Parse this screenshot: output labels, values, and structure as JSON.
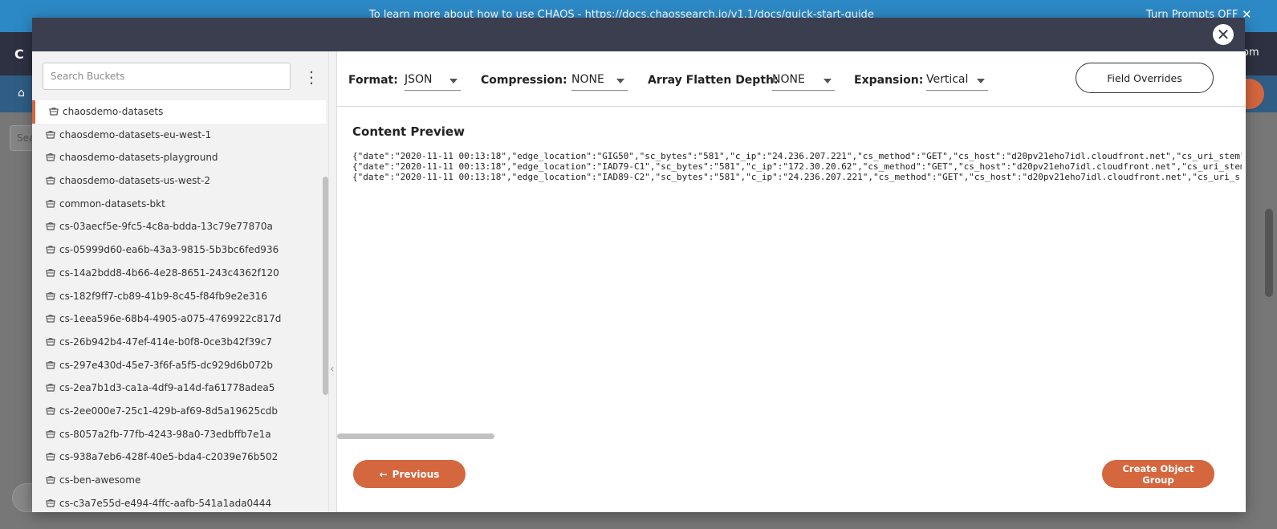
{
  "background": {
    "banner_text": "To learn more about how to use CHAOS - https://docs.chaossearch.io/v1.1/docs/quick-start-guide",
    "turn_prompts_label": "Turn Prompts OFF",
    "logo_partial": "C H",
    "user_partial": "om",
    "search_partial": "Sea"
  },
  "modal": {
    "close_icon": "close-icon"
  },
  "sidebar": {
    "search_placeholder": "Search Buckets",
    "menu_icon": "kebab-menu-icon",
    "collapse_icon": "chevron-left-icon",
    "buckets": [
      {
        "label": "chaosdemo-datasets",
        "selected": true
      },
      {
        "label": "chaosdemo-datasets-eu-west-1"
      },
      {
        "label": "chaosdemo-datasets-playground"
      },
      {
        "label": "chaosdemo-datasets-us-west-2"
      },
      {
        "label": "common-datasets-bkt"
      },
      {
        "label": "cs-03aecf5e-9fc5-4c8a-bdda-13c79e77870a"
      },
      {
        "label": "cs-05999d60-ea6b-43a3-9815-5b3bc6fed936"
      },
      {
        "label": "cs-14a2bdd8-4b66-4e28-8651-243c4362f120"
      },
      {
        "label": "cs-182f9ff7-cb89-41b9-8c45-f84fb9e2e316"
      },
      {
        "label": "cs-1eea596e-68b4-4905-a075-4769922c817d"
      },
      {
        "label": "cs-26b942b4-47ef-414e-b0f8-0ce3b42f39c7"
      },
      {
        "label": "cs-297e430d-45e7-3f6f-a5f5-dc929d6b072b"
      },
      {
        "label": "cs-2ea7b1d3-ca1a-4df9-a14d-fa61778adea5"
      },
      {
        "label": "cs-2ee000e7-25c1-429b-af69-8d5a19625cdb"
      },
      {
        "label": "cs-8057a2fb-77fb-4243-98a0-73edbffb7e1a"
      },
      {
        "label": "cs-938a7eb6-428f-40e5-bda4-c2039e76b502"
      },
      {
        "label": "cs-ben-awesome"
      },
      {
        "label": "cs-c3a7e55d-e494-4ffc-aafb-541a1ada0444"
      }
    ]
  },
  "toolbar": {
    "format": {
      "label": "Format:",
      "value": "JSON"
    },
    "compression": {
      "label": "Compression:",
      "value": "NONE"
    },
    "array_flatten": {
      "label": "Array Flatten Depth:",
      "value": "NONE"
    },
    "expansion": {
      "label": "Expansion:",
      "value": "Vertical"
    },
    "field_overrides_label": "Field Overrides"
  },
  "preview": {
    "title": "Content Preview",
    "lines": [
      "{\"date\":\"2020-11-11 00:13:18\",\"edge_location\":\"GIG50\",\"sc_bytes\":\"581\",\"c_ip\":\"24.236.207.221\",\"cs_method\":\"GET\",\"cs_host\":\"d20pv21eho7idl.cloudfront.net\",\"cs_uri_stem\"",
      "{\"date\":\"2020-11-11 00:13:18\",\"edge_location\":\"IAD79-C1\",\"sc_bytes\":\"581\",\"c_ip\":\"172.30.20.62\",\"cs_method\":\"GET\",\"cs_host\":\"d20pv21eho7idl.cloudfront.net\",\"cs_uri_stem\"",
      "{\"date\":\"2020-11-11 00:13:18\",\"edge_location\":\"IAD89-C2\",\"sc_bytes\":\"581\",\"c_ip\":\"24.236.207.221\",\"cs_method\":\"GET\",\"cs_host\":\"d20pv21eho7idl.cloudfront.net\",\"cs_uri_s"
    ]
  },
  "footer": {
    "previous_label": "Previous",
    "create_label": "Create Object Group"
  },
  "colors": {
    "accent": "#d4673e",
    "header": "#3a3e4f",
    "sidebar_bg": "#f2f2f2"
  }
}
